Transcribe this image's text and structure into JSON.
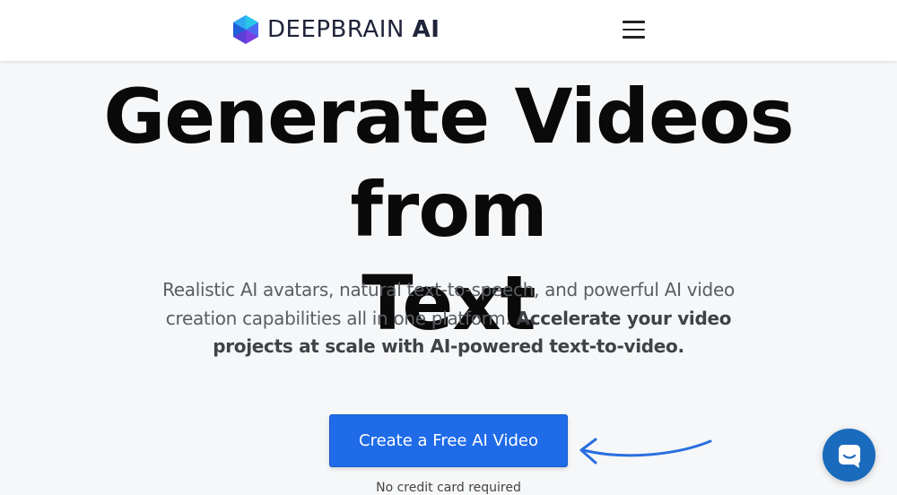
{
  "header": {
    "logo": {
      "brand": "DEEPBRAIN",
      "suffix": "AI"
    },
    "menu_icon": "hamburger-menu-icon"
  },
  "hero": {
    "title_line1": "Generate Videos from",
    "title_line2": "Text",
    "subtitle_regular": "Realistic AI avatars, natural text-to-speech, and powerful AI video creation capabilities all in one platform. ",
    "subtitle_bold": "Accelerate your video projects at scale with AI-powered text-to-video."
  },
  "cta": {
    "label": "Create a Free AI Video",
    "note": "No credit card required",
    "arrow_icon": "curved-arrow-icon"
  },
  "chat": {
    "icon": "chat-bubble-icon"
  },
  "colors": {
    "accent": "#1f6be8",
    "chat": "#1a6bbd",
    "background": "#f6f7f8"
  }
}
